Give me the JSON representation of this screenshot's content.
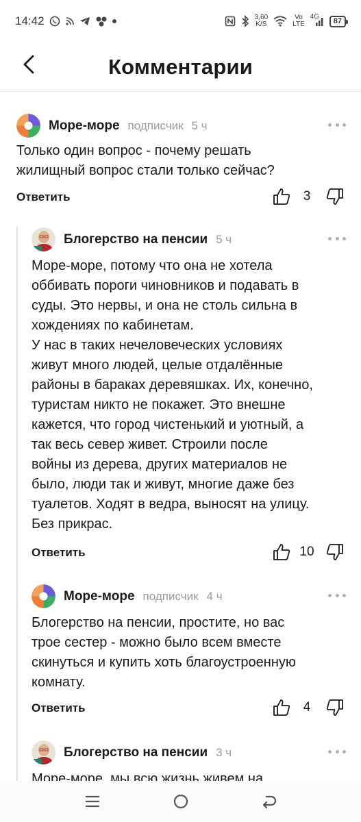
{
  "status_bar": {
    "time": "14:42",
    "net_speed_value": "3,60",
    "net_speed_unit": "K/S",
    "volte_top": "Vo",
    "volte_bottom": "LTE",
    "network": "4G",
    "battery": "87"
  },
  "header": {
    "title": "Комментарии",
    "back_icon": "chevron-left-icon"
  },
  "comments": [
    {
      "author": "Море-море",
      "badge": "подписчик",
      "time": "5 ч",
      "text": "Только один вопрос - почему  решать\nжилищный вопрос стали только сейчас?",
      "reply_label": "Ответить",
      "likes": "3",
      "avatar": "pinwheel-avatar"
    },
    {
      "author": "Блогерство на пенсии",
      "badge": "",
      "time": "5 ч",
      "text": "Море-море, потому что она не хотела\nоббивать пороги чиновников и подавать в\nсуды. Это нервы, и она не столь сильна в\nхождениях по кабинетам.\nУ нас в таких нечеловеческих условиях\nживут много людей, целые отдалённые\nрайоны в бараках деревяшках. Их, конечно,\nтуристам никто не покажет. Это внешне\nкажется, что город чистенький и уютный, а\nтак весь север живет. Строили после\nвойны из дерева, других материалов не\nбыло, люди так и живут, многие даже без\nтуалетов. Ходят в ведра, выносят на улицу.\nБез прикрас.",
      "reply_label": "Ответить",
      "likes": "10",
      "avatar": "photo-avatar"
    },
    {
      "author": "Море-море",
      "badge": "подписчик",
      "time": "4 ч",
      "text": "Блогерство на пенсии, простите, но вас\nтрое сестер - можно было всем вместе\nскинуться и купить хоть благоустроенную\nкомнату.",
      "reply_label": "Ответить",
      "likes": "4",
      "avatar": "pinwheel-avatar"
    },
    {
      "author": "Блогерство на пенсии",
      "badge": "",
      "time": "3 ч",
      "text": "Море-море, мы всю жизнь живем на",
      "reply_label": "",
      "likes": "",
      "avatar": "photo-avatar"
    }
  ],
  "nav_bar": {
    "menu_icon": "menu-icon",
    "home_icon": "home-circle-icon",
    "back_icon": "back-arrow-icon"
  },
  "colors": {
    "text": "#1a1a1a",
    "muted": "#9a9a9a",
    "divider": "#e6e6e6",
    "avatar_purple": "#6b5bd6",
    "avatar_orange": "#ef7d3a",
    "avatar_green": "#3fae63"
  }
}
